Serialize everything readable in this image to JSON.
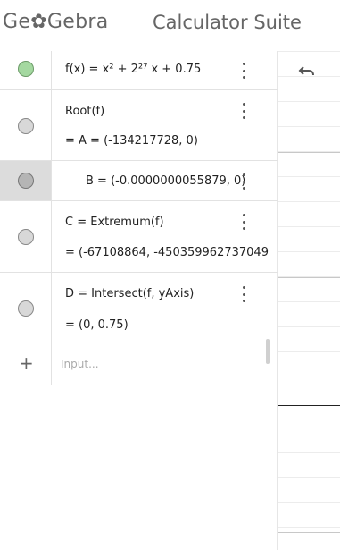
{
  "header": {
    "logo_pre": "Ge",
    "logo_glyph": "✿",
    "logo_post": "Gebra",
    "suite_title": "Calculator Suite"
  },
  "algebra": {
    "items": [
      {
        "line1": "f(x) = x² + 2²⁷ x + 0.75",
        "marble": "green"
      },
      {
        "line1": "Root(f)",
        "line2": "= A = (-134217728, 0)",
        "marble": "grey"
      },
      {
        "line1": "B = (-0.0000000055879, 0)",
        "marble": "grey",
        "selected": true
      },
      {
        "line1": "C = Extremum(f)",
        "line2": "= (-67108864, -450359962737049",
        "marble": "grey"
      },
      {
        "line1": "D = Intersect(f, yAxis)",
        "line2": "= (0, 0.75)",
        "marble": "grey"
      }
    ],
    "add_symbol": "+",
    "input_placeholder": "Input..."
  },
  "graphics": {
    "undo_icon": "undo-icon"
  },
  "colors": {
    "marble_green": "#a4d8a0",
    "marble_grey": "#d8d8d8",
    "selected_bg": "#dcdcdc"
  }
}
